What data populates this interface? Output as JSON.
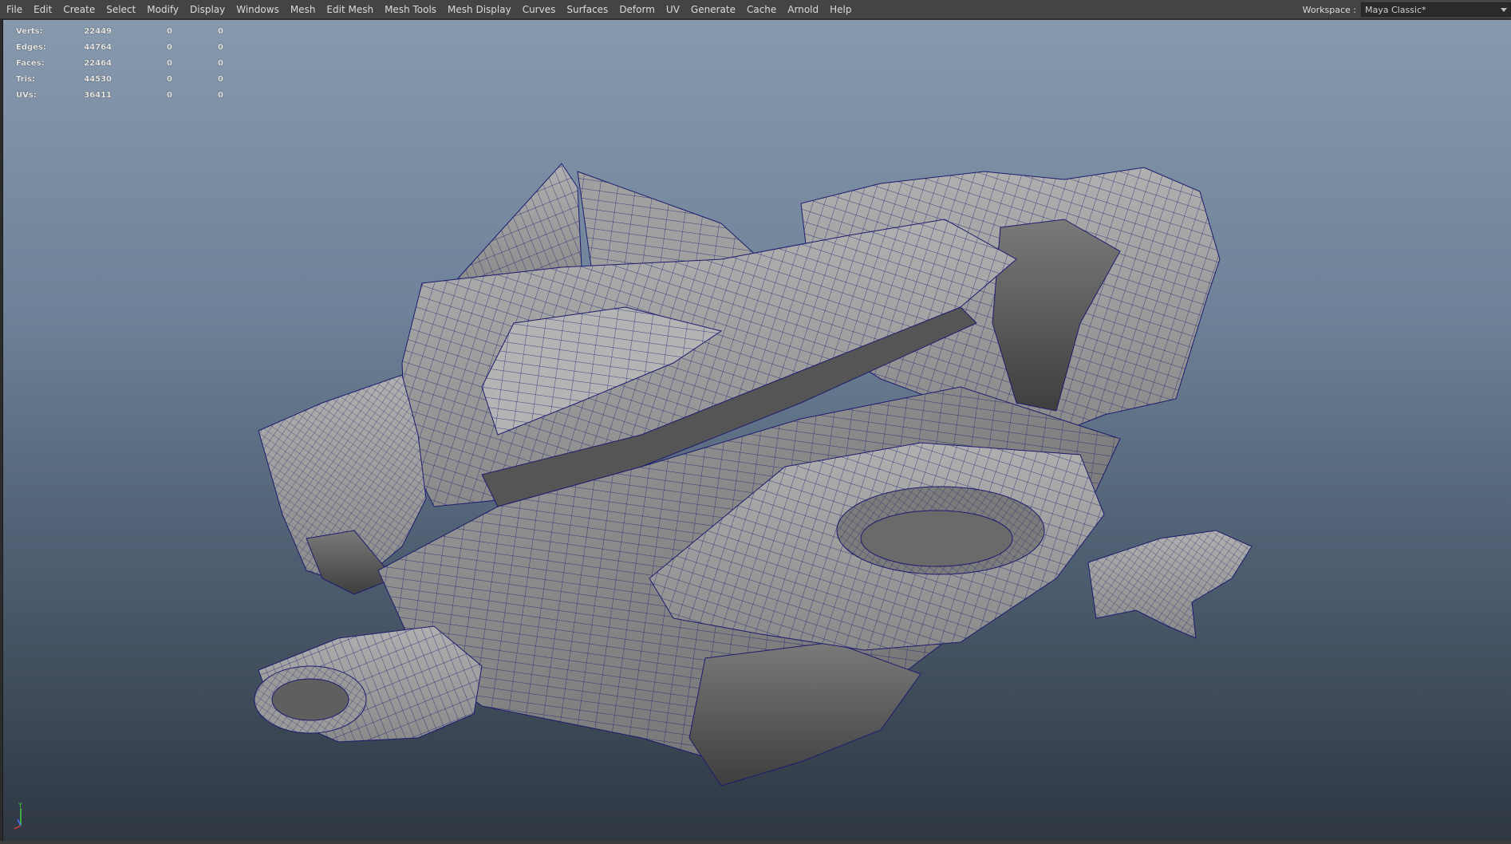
{
  "menubar": {
    "items": [
      "File",
      "Edit",
      "Create",
      "Select",
      "Modify",
      "Display",
      "Windows",
      "Mesh",
      "Edit Mesh",
      "Mesh Tools",
      "Mesh Display",
      "Curves",
      "Surfaces",
      "Deform",
      "UV",
      "Generate",
      "Cache",
      "Arnold",
      "Help"
    ]
  },
  "workspace": {
    "label": "Workspace :",
    "value": "Maya Classic*"
  },
  "hud": {
    "rows": [
      {
        "label": "Verts:",
        "value": "22449",
        "sel1": "0",
        "sel2": "0"
      },
      {
        "label": "Edges:",
        "value": "44764",
        "sel1": "0",
        "sel2": "0"
      },
      {
        "label": "Faces:",
        "value": "22464",
        "sel1": "0",
        "sel2": "0"
      },
      {
        "label": "Tris:",
        "value": "44530",
        "sel1": "0",
        "sel2": "0"
      },
      {
        "label": "UVs:",
        "value": "36411",
        "sel1": "0",
        "sel2": "0"
      }
    ]
  },
  "axis": {
    "y_label": "Y"
  },
  "colors": {
    "wire": "#1c1c6e",
    "mesh_light": "#a9a9a9",
    "mesh_mid": "#8f8f8f",
    "mesh_dark": "#5a5a5a",
    "axis_y": "#3fcf3f",
    "axis_x": "#cf3f3f",
    "axis_z": "#4f6fff"
  }
}
